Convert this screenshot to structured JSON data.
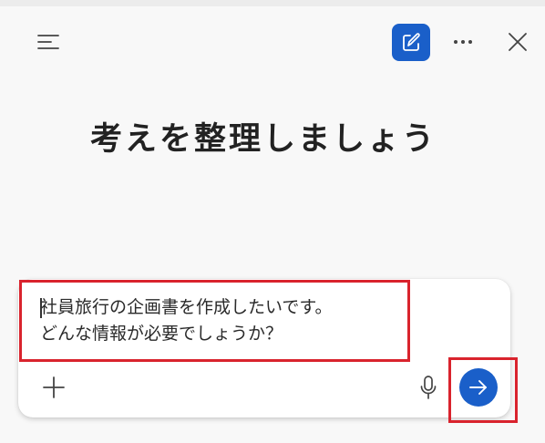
{
  "header": {
    "menu_icon": "hamburger-menu-icon",
    "new_chat_icon": "compose-edit-icon",
    "more_icon": "ellipsis-icon",
    "close_icon": "close-icon",
    "accent_color": "#1a5fc9"
  },
  "main": {
    "title": "考えを整理しましょう"
  },
  "composer": {
    "value": "社員旅行の企画書を作成したいです。\nどんな情報が必要でしょうか？",
    "add_icon": "plus-icon",
    "mic_icon": "microphone-icon",
    "send_icon": "arrow-right-icon"
  },
  "annotations": {
    "highlight_color": "#d9232d"
  }
}
